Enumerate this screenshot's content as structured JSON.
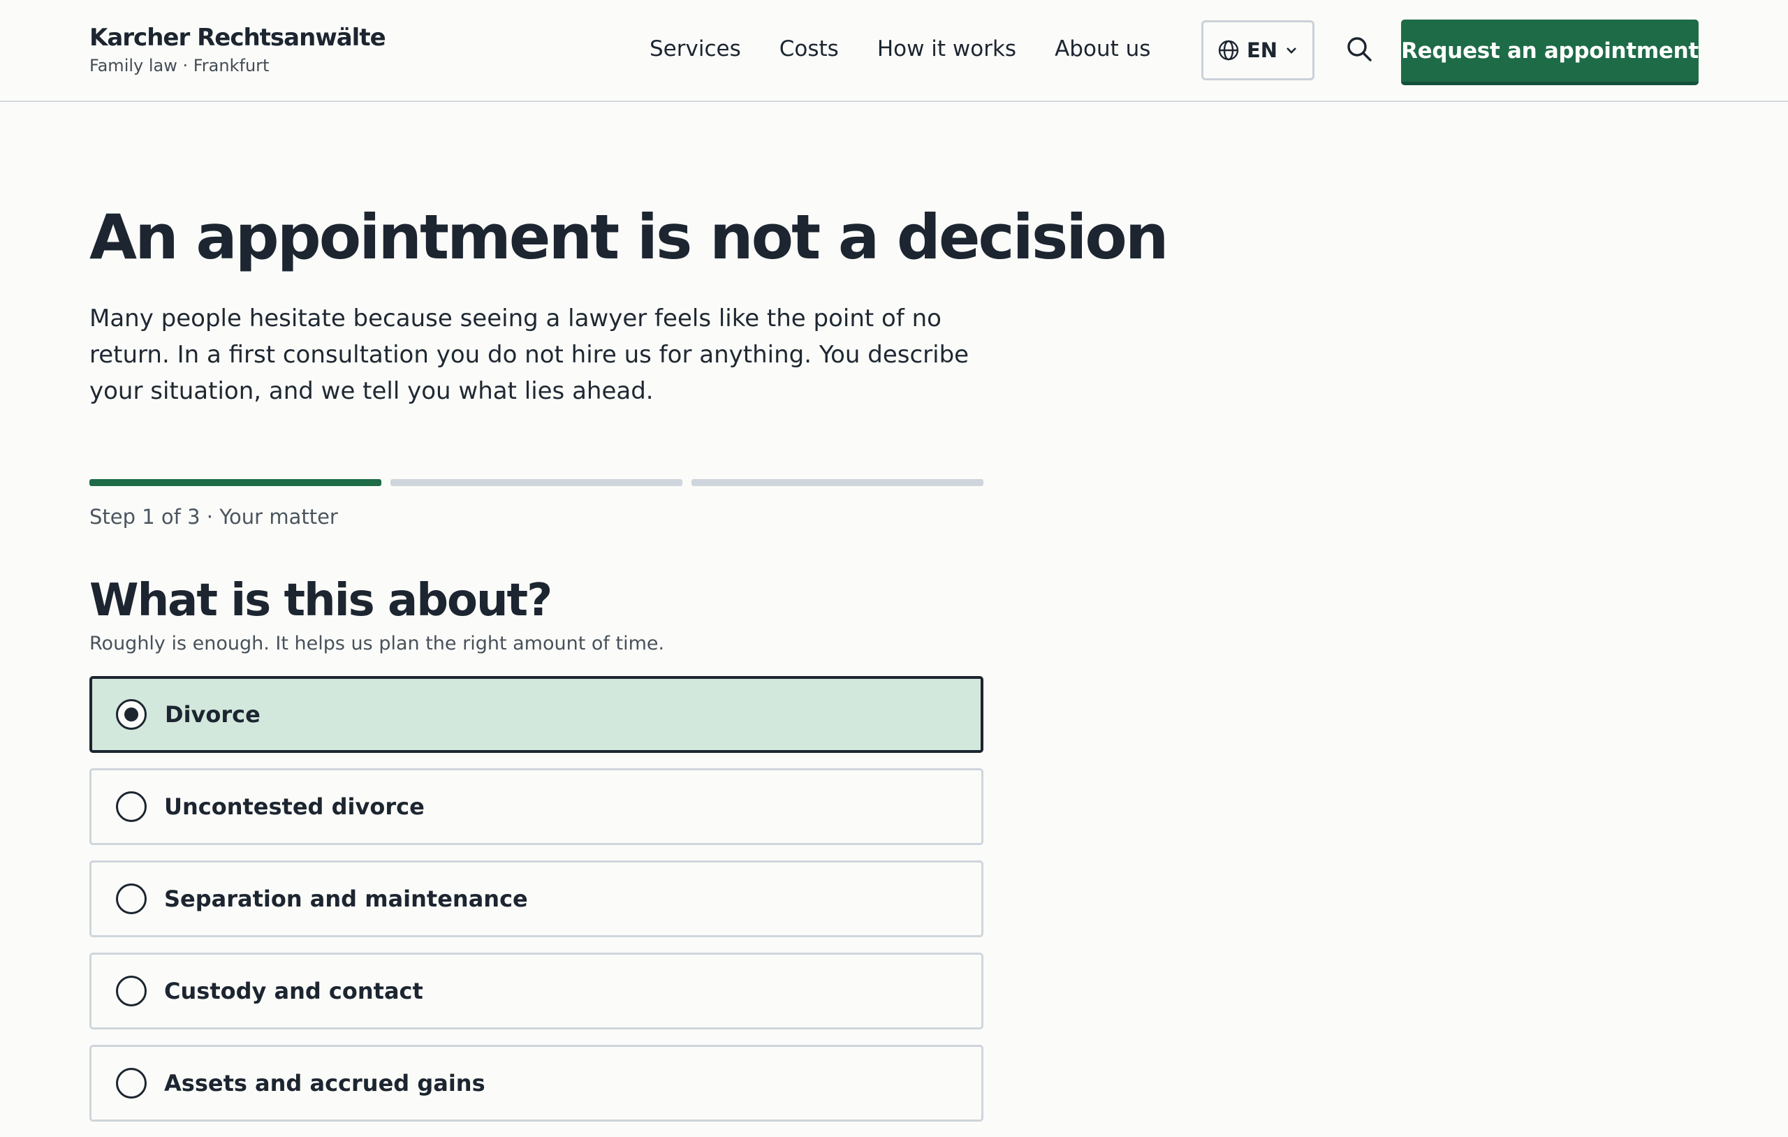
{
  "header": {
    "brand_name": "Karcher Rechtsanwälte",
    "brand_sub": "Family law · Frankfurt",
    "nav": [
      "Services",
      "Costs",
      "How it works",
      "About us"
    ],
    "language": "EN",
    "cta": "Request an appointment"
  },
  "main": {
    "title": "An appointment is not a decision",
    "intro": "Many people hesitate because seeing a lawyer feels like the point of no return. In a first consultation you do not hire us for anything. You describe your situation, and we tell you what lies ahead.",
    "progress": {
      "current_step": 1,
      "total_steps": 3
    },
    "step_label": "Step 1 of 3 · Your matter",
    "question": "What is this about?",
    "hint": "Roughly is enough. It helps us plan the right amount of time.",
    "options": [
      {
        "label": "Divorce",
        "selected": true
      },
      {
        "label": "Uncontested divorce",
        "selected": false
      },
      {
        "label": "Separation and maintenance",
        "selected": false
      },
      {
        "label": "Custody and contact",
        "selected": false
      },
      {
        "label": "Assets and accrued gains",
        "selected": false
      }
    ]
  },
  "colors": {
    "accent": "#1e6b47",
    "selected_bg": "#d3e8dc",
    "text": "#1c2530",
    "border": "#cfd5dc",
    "background": "#fbfcf9"
  },
  "icons": [
    "globe-icon",
    "chevron-down-icon",
    "search-icon",
    "radio-icon"
  ]
}
